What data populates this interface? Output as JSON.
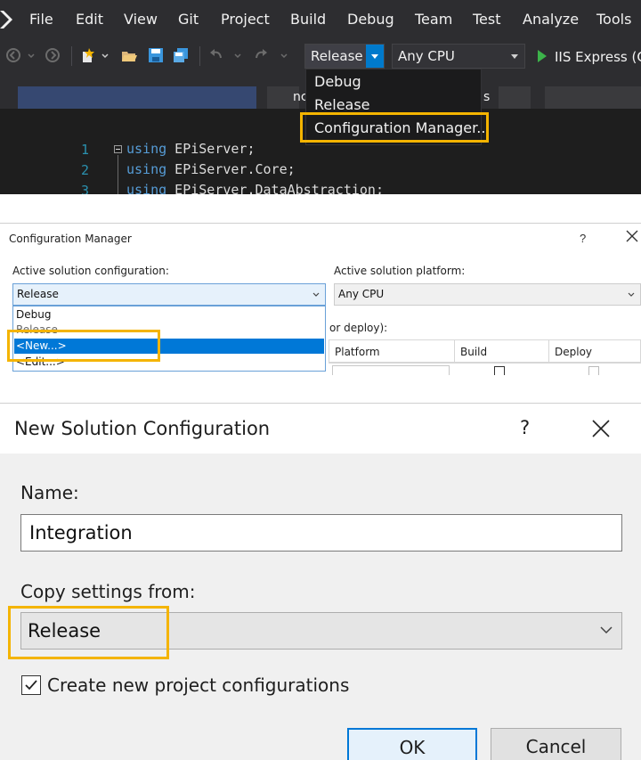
{
  "vs": {
    "menu": [
      "File",
      "Edit",
      "View",
      "Git",
      "Project",
      "Build",
      "Debug",
      "Team",
      "Test",
      "Analyze",
      "Tools"
    ],
    "toolbar": {
      "configuration_value": "Release",
      "platform_value": "Any CPU",
      "run_label": "IIS Express (C"
    },
    "config_dropdown": {
      "items": [
        "Debug",
        "Release",
        "Configuration Manager..."
      ]
    },
    "tab_fragment_1": "nc",
    "tab_fragment_2": "s",
    "editor": {
      "line_numbers": [
        "1",
        "2",
        "3"
      ],
      "lines": [
        {
          "keyword": "using",
          "rest": " EPiServer;"
        },
        {
          "keyword": "using",
          "rest": " EPiServer.Core;"
        },
        {
          "keyword": "using",
          "rest": " EPiServer.DataAbstraction;"
        }
      ]
    }
  },
  "config_manager": {
    "title": "Configuration Manager",
    "help": "?",
    "active_config_label": "Active solution configuration:",
    "active_config_value": "Release",
    "active_platform_label": "Active solution platform:",
    "active_platform_value": "Any CPU",
    "config_list": [
      "Debug",
      "Release",
      "<New...>",
      "<Edit...>"
    ],
    "grid_hint": "or deploy):",
    "columns": [
      "Platform",
      "Build",
      "Deploy"
    ]
  },
  "new_solution_config": {
    "title": "New Solution Configuration",
    "help": "?",
    "name_label": "Name:",
    "name_value": "Integration",
    "copy_label": "Copy settings from:",
    "copy_value": "Release",
    "checkbox_label": "Create new project configurations",
    "checkbox_checked": true,
    "ok_label": "OK",
    "cancel_label": "Cancel"
  },
  "colors": {
    "highlight": "#f4b400",
    "accent": "#007acc",
    "selection": "#0078d7"
  }
}
